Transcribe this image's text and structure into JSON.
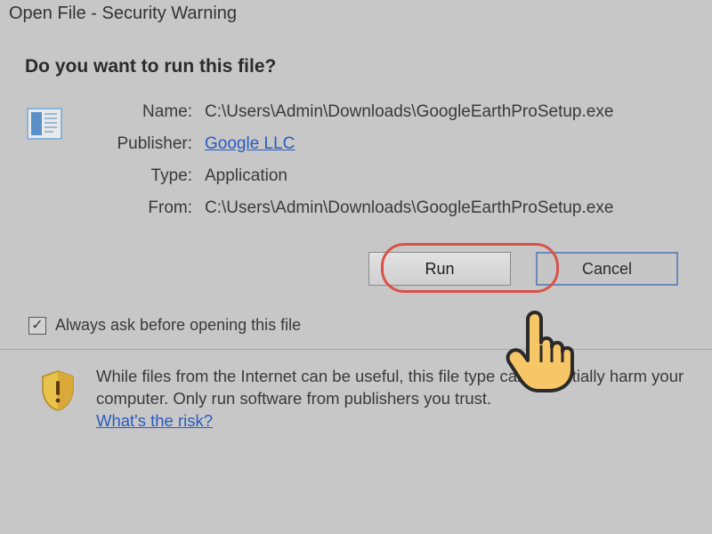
{
  "title": "Open File - Security Warning",
  "question": "Do you want to run this file?",
  "fields": {
    "name_label": "Name:",
    "name_value": "C:\\Users\\Admin\\Downloads\\GoogleEarthProSetup.exe",
    "publisher_label": "Publisher:",
    "publisher_value": "Google LLC",
    "type_label": "Type:",
    "type_value": "Application",
    "from_label": "From:",
    "from_value": "C:\\Users\\Admin\\Downloads\\GoogleEarthProSetup.exe"
  },
  "buttons": {
    "run": "Run",
    "cancel": "Cancel"
  },
  "checkbox": {
    "label": "Always ask before opening this file",
    "checked": true
  },
  "warning": {
    "text": "While files from the Internet can be useful, this file type can potentially harm your computer. Only run software from publishers you trust.",
    "risk_link": "What's the risk?"
  }
}
